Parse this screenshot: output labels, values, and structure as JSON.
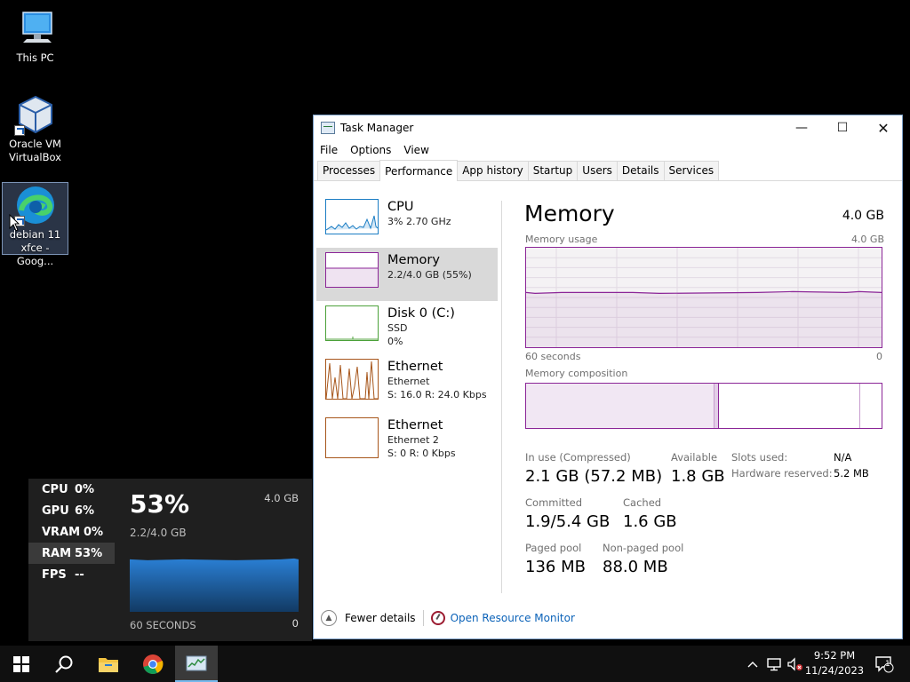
{
  "desktop": {
    "icons": [
      {
        "label1": "This PC",
        "label2": ""
      },
      {
        "label1": "Oracle VM",
        "label2": "VirtualBox"
      },
      {
        "label1": "debian 11",
        "label2": "xfce - Goog..."
      }
    ]
  },
  "window": {
    "title": "Task Manager",
    "menu": [
      "File",
      "Options",
      "View"
    ],
    "tabs": [
      "Processes",
      "Performance",
      "App history",
      "Startup",
      "Users",
      "Details",
      "Services"
    ],
    "active_tab": "Performance"
  },
  "perf_list": [
    {
      "name": "CPU",
      "line1": "3% 2.70 GHz",
      "line2": "",
      "color": "#1b7dc4"
    },
    {
      "name": "Memory",
      "line1": "2.2/4.0 GB (55%)",
      "line2": "",
      "color": "#8b2597"
    },
    {
      "name": "Disk 0 (C:)",
      "line1": "SSD",
      "line2": "0%",
      "color": "#4ca13a"
    },
    {
      "name": "Ethernet",
      "line1": "Ethernet",
      "line2": "S: 16.0  R: 24.0 Kbps",
      "color": "#a7561b"
    },
    {
      "name": "Ethernet",
      "line1": "Ethernet 2",
      "line2": "S: 0  R: 0 Kbps",
      "color": "#a7561b"
    }
  ],
  "memory": {
    "title": "Memory",
    "total": "4.0 GB",
    "usage_label": "Memory usage",
    "usage_max": "4.0 GB",
    "time_left": "60 seconds",
    "time_right": "0",
    "usage_level_fraction": 0.55,
    "composition_label": "Memory composition",
    "stats": {
      "in_use_label": "In use (Compressed)",
      "in_use_value": "2.1 GB (57.2 MB)",
      "available_label": "Available",
      "available_value": "1.8 GB",
      "committed_label": "Committed",
      "committed_value": "1.9/5.4 GB",
      "cached_label": "Cached",
      "cached_value": "1.6 GB",
      "paged_label": "Paged pool",
      "paged_value": "136 MB",
      "nonpaged_label": "Non-paged pool",
      "nonpaged_value": "88.0 MB",
      "slots_label": "Slots used:",
      "slots_value": "N/A",
      "hw_label": "Hardware reserved:",
      "hw_value": "5.2 MB"
    }
  },
  "footer": {
    "fewer_details": "Fewer details",
    "open_rm": "Open Resource Monitor"
  },
  "gamebar": {
    "rows": [
      {
        "k": "CPU",
        "v": "0%"
      },
      {
        "k": "GPU",
        "v": "6%"
      },
      {
        "k": "VRAM",
        "v": "0%"
      },
      {
        "k": "RAM",
        "v": "53%"
      },
      {
        "k": "FPS",
        "v": "--"
      }
    ],
    "selected": "RAM",
    "big": "53%",
    "sub": "2.2/4.0 GB",
    "cap": "4.0 GB",
    "seconds": "60 SECONDS",
    "zero": "0",
    "ram_fraction": 0.53
  },
  "taskbar": {
    "time": "9:52 PM",
    "date": "11/24/2023",
    "notif_count": "1"
  },
  "colors": {
    "accent_memory": "#8b2597",
    "link": "#0b62b8",
    "gamebar_fill": "#1d5fa6"
  }
}
